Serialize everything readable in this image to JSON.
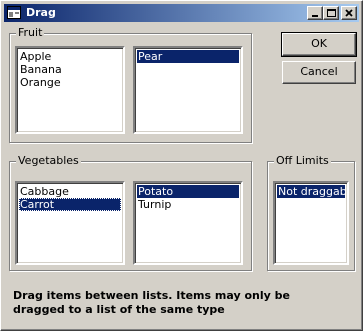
{
  "window": {
    "title": "Drag",
    "caption_buttons": [
      "minimize-icon",
      "maximize-icon",
      "close-icon"
    ]
  },
  "fruit": {
    "label": "Fruit",
    "left_list": [
      {
        "text": "Apple",
        "selected": false
      },
      {
        "text": "Banana",
        "selected": false
      },
      {
        "text": "Orange",
        "selected": false
      }
    ],
    "right_list": [
      {
        "text": "Pear",
        "selected": true
      }
    ]
  },
  "vegetables": {
    "label": "Vegetables",
    "left_list": [
      {
        "text": "Cabbage",
        "selected": false
      },
      {
        "text": "Carrot",
        "selected": true,
        "focused": true
      }
    ],
    "right_list": [
      {
        "text": "Potato",
        "selected": true
      },
      {
        "text": "Turnip",
        "selected": false
      }
    ]
  },
  "off_limits": {
    "label": "Off Limits",
    "list": [
      {
        "text": "Not draggable",
        "selected": true
      }
    ]
  },
  "buttons": {
    "ok": "OK",
    "cancel": "Cancel"
  },
  "info": {
    "text": "Drag items between lists. Items may only be dragged to a list of the same type"
  },
  "colors": {
    "face": "#d4d0c8",
    "titlebar_start": "#0a246a",
    "titlebar_end": "#a6caf0",
    "selection": "#0a246a"
  }
}
